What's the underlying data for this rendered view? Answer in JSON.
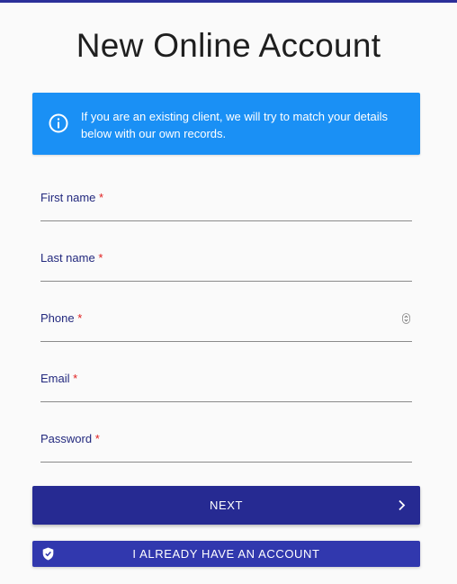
{
  "page": {
    "title": "New Online Account"
  },
  "info_banner": {
    "text": "If you are an existing client, we will try to match your details below with our own records.",
    "icon": "info-icon",
    "color": "#1a90f5"
  },
  "form": {
    "fields": [
      {
        "label": "First name",
        "required_mark": "*",
        "value": ""
      },
      {
        "label": "Last name",
        "required_mark": "*",
        "value": ""
      },
      {
        "label": "Phone",
        "required_mark": "*",
        "value": ""
      },
      {
        "label": "Email",
        "required_mark": "*",
        "value": ""
      },
      {
        "label": "Password",
        "required_mark": "*",
        "value": ""
      }
    ]
  },
  "actions": {
    "next_label": "NEXT",
    "next_icon": "chevron-right-icon",
    "account_label": "I ALREADY HAVE AN ACCOUNT",
    "account_icon": "shield-check-icon",
    "primary_color": "#262a92",
    "secondary_color": "#3138ae"
  }
}
